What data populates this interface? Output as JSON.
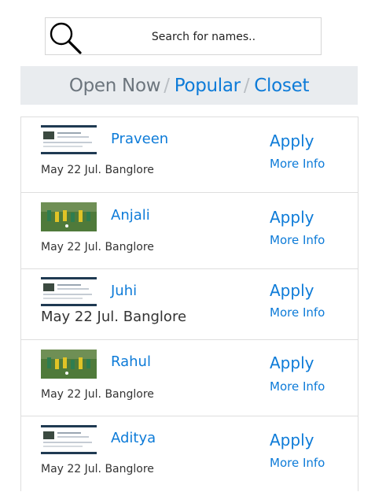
{
  "search": {
    "placeholder": "Search for names..",
    "icon": "search-icon"
  },
  "breadcrumb": {
    "active": "Open Now",
    "separator": "/",
    "links": [
      "Popular",
      "Closet"
    ]
  },
  "colors": {
    "link": "#0d7bd8",
    "muted": "#6c757d",
    "bar": "#e9ecef"
  },
  "list": {
    "items": [
      {
        "name": "Praveen",
        "location": "May 22 Jul. Banglore",
        "apply": "Apply",
        "more": "More Info",
        "thumb": "screenshot-thumbnail"
      },
      {
        "name": "Anjali",
        "location": "May 22 Jul. Banglore",
        "apply": "Apply",
        "more": "More Info",
        "thumb": "soccer-photo-thumbnail"
      },
      {
        "name": "Juhi",
        "location": "May 22 Jul. Banglore",
        "apply": "Apply",
        "more": "More Info",
        "thumb": "screenshot-thumbnail"
      },
      {
        "name": "Rahul",
        "location": "May 22 Jul. Banglore",
        "apply": "Apply",
        "more": "More Info",
        "thumb": "soccer-photo-thumbnail"
      },
      {
        "name": "Aditya",
        "location": "May 22 Jul. Banglore",
        "apply": "Apply",
        "more": "More Info",
        "thumb": "screenshot-thumbnail"
      }
    ]
  }
}
